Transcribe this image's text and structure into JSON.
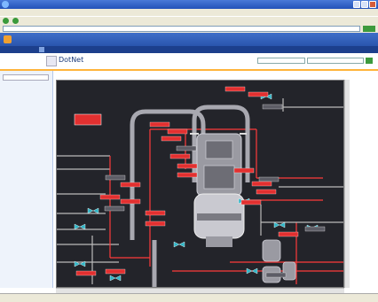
{
  "browser": {
    "title": "",
    "menu": "",
    "address": "",
    "status_zone": ""
  },
  "sharepoint": {
    "brand": "",
    "header_links": "",
    "nav_tabs": [
      "",
      "",
      "",
      "",
      "",
      ""
    ],
    "site_title": "DotNet",
    "site_subtitle": "",
    "left_nav_heading": "",
    "left_nav_home": "",
    "left_nav_box": "",
    "left_nav_actions": "",
    "left_nav_items": [
      "",
      "",
      "",
      "",
      "",
      "",
      ""
    ],
    "page_title": ""
  },
  "diagram": {
    "heading": "",
    "alarm": "",
    "tag_labels": [
      "",
      "",
      "",
      "",
      "",
      "",
      "",
      "",
      "",
      "",
      "",
      "",
      "",
      "",
      "",
      "",
      "",
      "",
      "",
      "",
      "",
      "",
      "",
      "",
      "",
      "",
      ""
    ],
    "side_labels": [
      "",
      "",
      "",
      "",
      "",
      ""
    ]
  },
  "colors": {
    "header_blue": "#2a55ad",
    "nav_dark": "#1c3f8c",
    "accent_orange": "#ffb43a",
    "diagram_bg": "#23242a",
    "alarm_red": "#e23030",
    "pipe_red": "#ff3b3b",
    "vessel_grey": "#a8a8b0"
  }
}
